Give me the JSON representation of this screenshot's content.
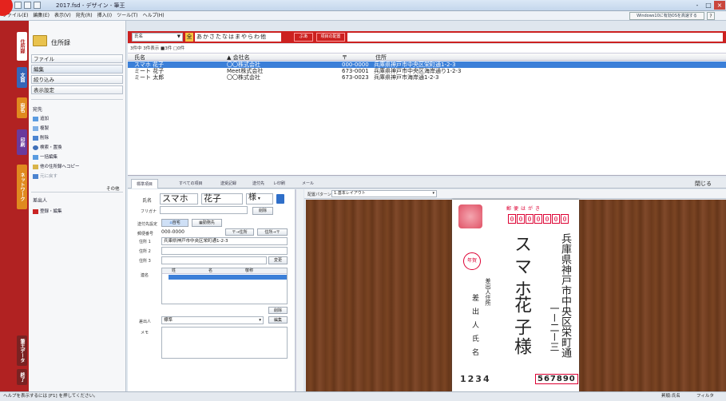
{
  "window": {
    "title": "2017.fsd - デザイン - 筆王",
    "minimize": "-",
    "maximize": "□",
    "close": "×"
  },
  "menu": [
    "ファイル(E)",
    "編集(E)",
    "表示(V)",
    "宛先(R)",
    "挿入(I)",
    "ツール(T)",
    "ヘルプ(H)"
  ],
  "notice": "Windows10に有効OSを高速する",
  "vertical_tabs": [
    "住所録",
    "文面",
    "宛名",
    "印刷",
    "ネットワーク",
    "筆王データ",
    "終了"
  ],
  "nav": {
    "title": "住所録",
    "buttons": [
      "ファイル",
      "編集",
      "絞り込み",
      "表示設定"
    ],
    "section_destination": "宛先",
    "destination_items": [
      "追加",
      "複製",
      "削除",
      "検索・置換",
      "一括編集",
      "他の住所録へコピー",
      "元に戻す"
    ],
    "other": "その他",
    "section_sender": "差出人",
    "sender_items": [
      "登録・編集"
    ]
  },
  "toolbar": {
    "search_field": "氏名",
    "kana_label": "全",
    "kana": "あかさたなはまやらわ他",
    "sort_button": "ぶあ",
    "order_label": "項目の配置"
  },
  "list": {
    "count": "3件中 3件表示 ■3件 □0件",
    "headers": {
      "name": "氏名",
      "company": "▲ 会社名",
      "zip": "〒",
      "address": "住所"
    },
    "rows": [
      {
        "name": "スマホ 花子",
        "company": "〇〇株式会社",
        "zip": "000-0000",
        "address": "兵庫県神戸市中央区栄町通1-2-3",
        "selected": true
      },
      {
        "name": "ミート 花子",
        "company": "Meet株式会社",
        "zip": "673-0001",
        "address": "兵庫県神戸市中央区海岸通り1-2-3",
        "selected": false
      },
      {
        "name": "ミート 太郎",
        "company": "〇〇株式会社",
        "zip": "673-0023",
        "address": "兵庫県神戸市海岸通1-2-3",
        "selected": false
      }
    ]
  },
  "detail_tabs": [
    "標準項目",
    "すべての項目",
    "送受記録",
    "送付先",
    "レ印刷",
    "メール"
  ],
  "close_label": "閉じる",
  "form": {
    "name_label": "氏名",
    "surname": "スマホ",
    "given": "花子",
    "honorific": "様",
    "furigana_label": "フリガナ",
    "delete_label": "削除",
    "dest_setting_label": "送付先設定",
    "home_tab": "自宅",
    "work_tab": "勤務先",
    "zip_label": "郵便番号",
    "zip_value": "000-0000",
    "zip_to_addr": "〒→住所",
    "addr_to_zip": "住所→〒",
    "addr1_label": "住所 1",
    "addr1": "兵庫県神戸市中央区栄町通1-2-3",
    "addr2_label": "住所 2",
    "addr3_label": "住所 3",
    "change_label": "変更",
    "joint_label": "連名",
    "joint_headers": [
      "姓",
      "名",
      "敬称"
    ],
    "sender_label": "差出人",
    "sender_value": "標準",
    "edit_label": "編集",
    "memo_label": "メモ"
  },
  "preview": {
    "pattern_label": "配置パターン",
    "pattern_value": "1.基本レイアウト",
    "postcard_header": "郵便はがき",
    "zip_digits": [
      "0",
      "0",
      "0",
      "0",
      "0",
      "0",
      "0"
    ],
    "address_vertical": "兵庫県神戸市中央区栄町通",
    "address_number": "一ー二ー三",
    "recipient": "スマホ",
    "recipient_given": "花子",
    "honorific": "様",
    "sender_address": "差出人住所",
    "sender_name": "差出人氏名",
    "sender_zip": "1234",
    "bottom_code": "567890",
    "stamp": "年賀"
  },
  "status": {
    "help": "ヘルプを表示するには [F1] を押してください。",
    "sort": "昇順:氏名",
    "filter": "フィルタ"
  },
  "colors": {
    "accent": "#cc2120",
    "selection": "#3b7fd8"
  }
}
